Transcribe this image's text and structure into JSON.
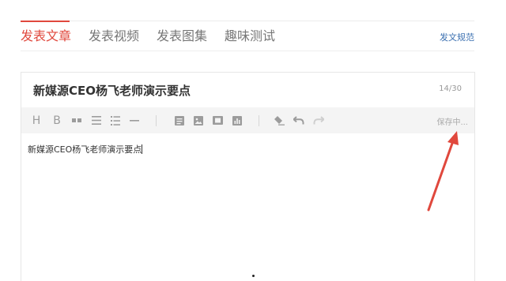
{
  "nav": {
    "tabs": [
      {
        "label": "发表文章",
        "active": true
      },
      {
        "label": "发表视频",
        "active": false
      },
      {
        "label": "发表图集",
        "active": false
      },
      {
        "label": "趣味测试",
        "active": false
      }
    ],
    "rules_link": "发文规范"
  },
  "editor": {
    "title": "新媒源CEO杨飞老师演示要点",
    "char_count": "14/30",
    "status": "保存中...",
    "content": "新媒源CEO杨飞老师演示要点",
    "toolbar": {
      "heading_label": "H",
      "bold_label": "B",
      "icons": [
        "quote-icon",
        "unordered-list-icon",
        "ordered-list-icon",
        "horizontal-rule-icon",
        "document-icon",
        "image-icon",
        "video-icon",
        "chart-icon",
        "clear-format-icon",
        "undo-icon",
        "redo-icon"
      ]
    }
  },
  "colors": {
    "accent": "#e0483d",
    "link": "#3a6fb0",
    "toolbar_bg": "#f4f4f4",
    "annotation_arrow": "#e0483d"
  }
}
